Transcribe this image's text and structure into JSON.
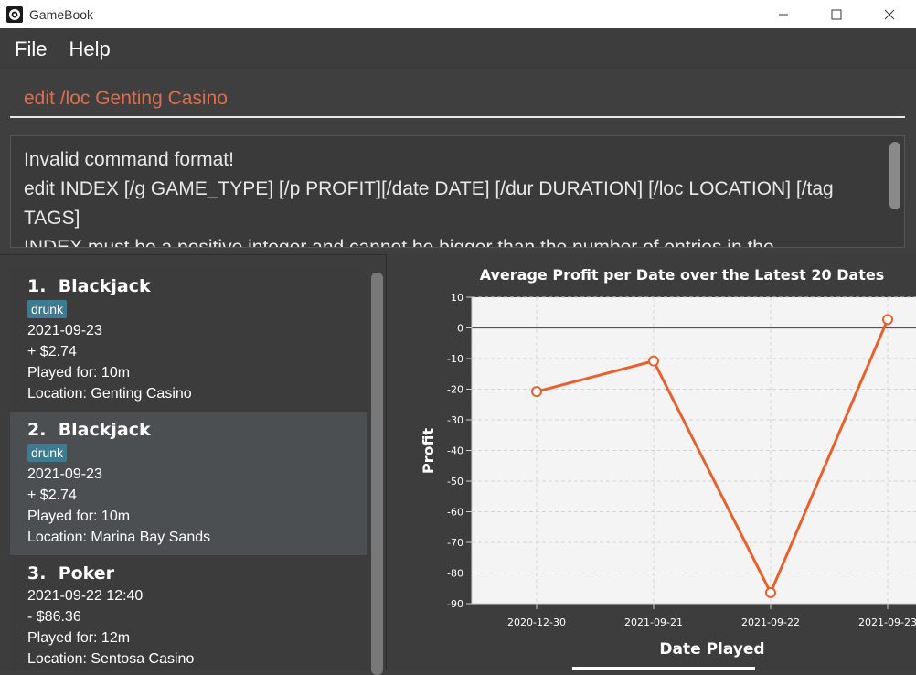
{
  "window": {
    "title": "GameBook"
  },
  "menu": {
    "items": [
      "File",
      "Help"
    ]
  },
  "command": {
    "value": "edit /loc Genting Casino"
  },
  "result": {
    "lines": [
      "Invalid command format!",
      "edit INDEX [/g GAME_TYPE] [/p PROFIT][/date DATE] [/dur DURATION] [/loc LOCATION] [/tag TAGS]",
      "INDEX must be a positive integer and cannot be bigger than the number of entries in the"
    ]
  },
  "entries": [
    {
      "index": "1.",
      "game": "Blackjack",
      "tag": "drunk",
      "date": "2021-09-23",
      "profit": "+ $2.74",
      "played_for": "Played for: 10m",
      "location": "Location: Genting Casino"
    },
    {
      "index": "2.",
      "game": "Blackjack",
      "tag": "drunk",
      "date": "2021-09-23",
      "profit": "+ $2.74",
      "played_for": "Played for: 10m",
      "location": "Location: Marina Bay Sands"
    },
    {
      "index": "3.",
      "game": "Poker",
      "tag": "",
      "date": "2021-09-22 12:40",
      "profit": "- $86.36",
      "played_for": "Played for: 12m",
      "location": "Location: Sentosa Casino"
    }
  ],
  "colors": {
    "accent": "#e8602c",
    "tag": "#3e7b91",
    "command_text": "#e06d4d"
  },
  "chart_data": {
    "type": "line",
    "title": "Average Profit per Date over the Latest 20 Dates",
    "xlabel": "Date Played",
    "ylabel": "Profit",
    "categories": [
      "2020-12-30",
      "2021-09-21",
      "2021-09-22",
      "2021-09-23"
    ],
    "values": [
      -20.8,
      -10.8,
      -86.4,
      2.74
    ],
    "ylim": [
      -90,
      10
    ],
    "yticks": [
      10,
      0,
      -10,
      -20,
      -30,
      -40,
      -50,
      -60,
      -70,
      -80,
      -90
    ],
    "grid": true
  }
}
